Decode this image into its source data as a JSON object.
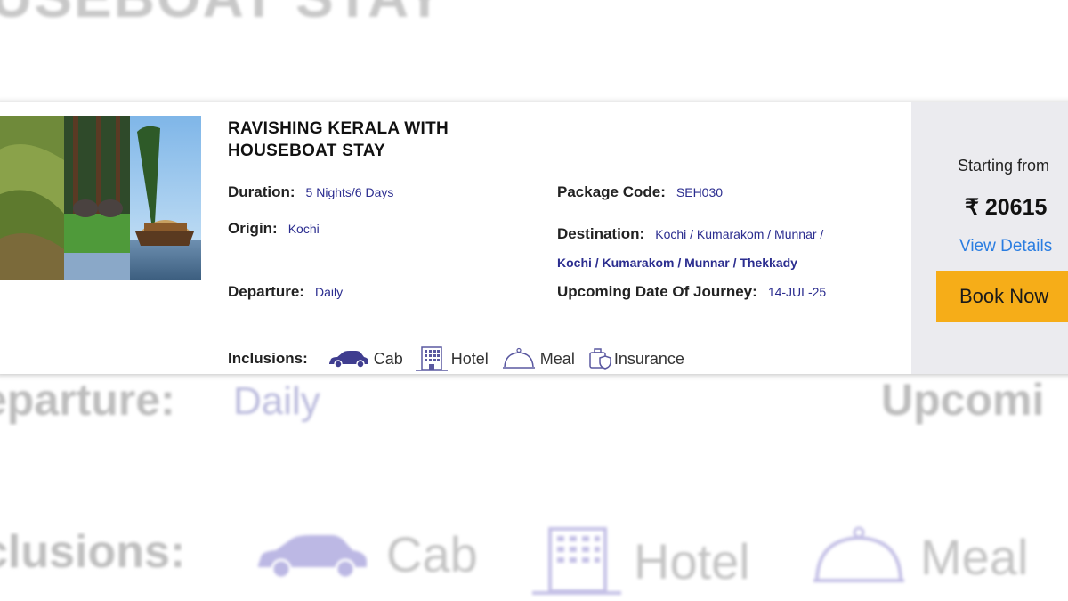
{
  "background": {
    "title_fragment": "USEBOAT STAY",
    "departure_label": "eparture:",
    "departure_value": "Daily",
    "upcoming_fragment": "Upcomi",
    "inclusions_label": "clusions:",
    "inclusions": [
      "Cab",
      "Hotel",
      "Meal"
    ]
  },
  "package": {
    "title_line1": "RAVISHING KERALA WITH",
    "title_line2": "HOUSEBOAT STAY",
    "duration_label": "Duration:",
    "duration_value": "5 Nights/6 Days",
    "code_label": "Package Code:",
    "code_value": "SEH030",
    "origin_label": "Origin:",
    "origin_value": "Kochi",
    "destination_label": "Destination:",
    "destination_line1": "Kochi / Kumarakom / Munnar /",
    "destination_line2": "Kochi / Kumarakom / Munnar / Thekkady",
    "departure_label": "Departure:",
    "departure_value": "Daily",
    "upcoming_label": "Upcoming Date Of Journey:",
    "upcoming_value": "14-JUL-25",
    "inclusions_label": "Inclusions:",
    "inclusions": [
      {
        "label": "Cab",
        "icon": "car-icon"
      },
      {
        "label": "Hotel",
        "icon": "hotel-icon"
      },
      {
        "label": "Meal",
        "icon": "meal-cloche-icon"
      },
      {
        "label": "Insurance",
        "icon": "insurance-icon"
      }
    ]
  },
  "pricing": {
    "starting_label": "Starting from",
    "price": "₹ 20615",
    "view_details": "View Details",
    "book_now": "Book Now"
  },
  "colors": {
    "accent": "#f6ad18",
    "link": "#2a7de1",
    "value_text": "#2b2d8f",
    "icon": "#3f3d8f",
    "panel_bg": "#ebebef"
  }
}
